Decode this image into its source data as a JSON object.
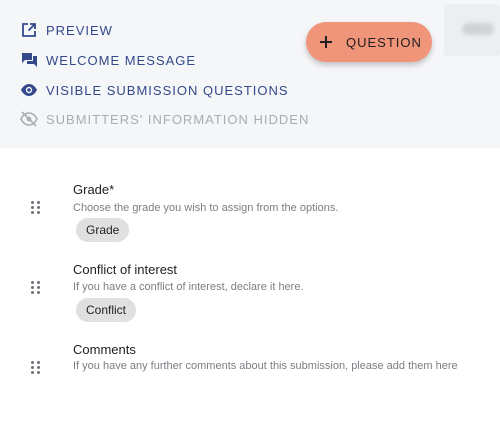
{
  "menu": {
    "preview": "PREVIEW",
    "welcome_message": "WELCOME MESSAGE",
    "visible_questions": "VISIBLE SUBMISSION QUESTIONS",
    "submitters_hidden": "SUBMITTERS' INFORMATION HIDDEN"
  },
  "fab": {
    "label": "QUESTION",
    "color": "#f1957a"
  },
  "accent_color": "#33498c",
  "questions": [
    {
      "title": "Grade*",
      "description": "Choose the grade you wish to assign from the options.",
      "chip": "Grade"
    },
    {
      "title": "Conflict of interest",
      "description": "If you have a conflict of interest, declare it here.",
      "chip": "Conflict"
    },
    {
      "title": "Comments",
      "description": "If you have any further comments about this submission, please add them here"
    }
  ]
}
